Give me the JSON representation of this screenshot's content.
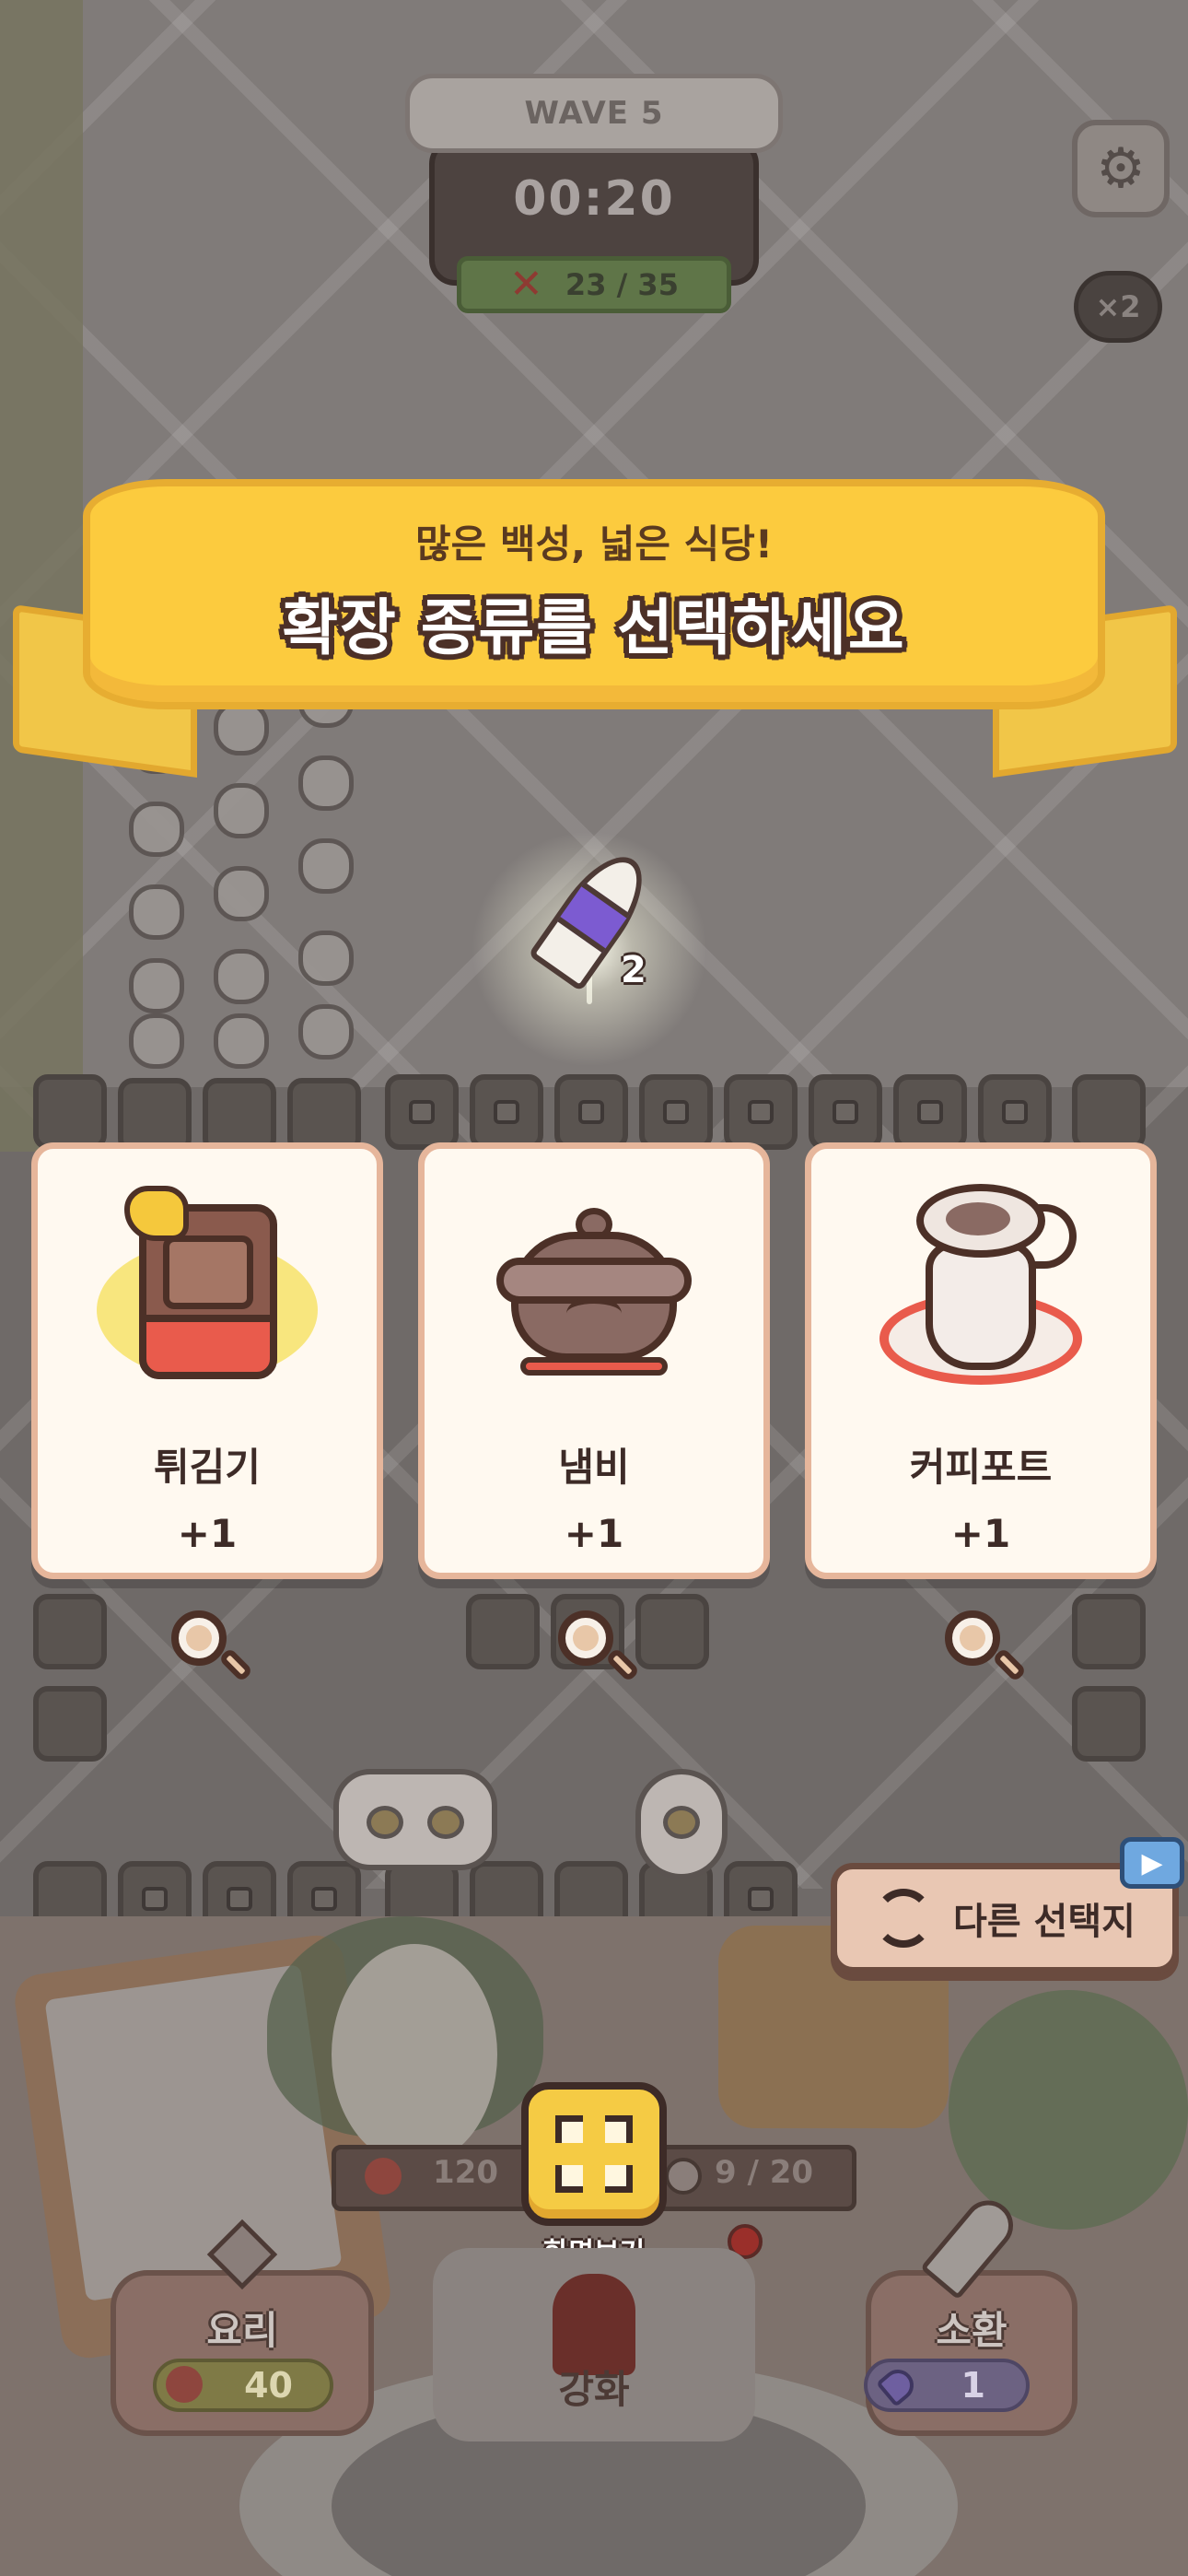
{
  "hud": {
    "wave_label": "WAVE 5",
    "timer": "00:20",
    "kill_count": "23 / 35",
    "speed_label": "×2",
    "settings_icon": "gear-icon"
  },
  "banner": {
    "subtitle": "많은 백성, 넓은 식당!",
    "title": "확장 종류를 선택하세요"
  },
  "reward": {
    "icon": "horn-icon",
    "count": "2"
  },
  "choices": [
    {
      "name": "튀김기",
      "bonus": "+1",
      "icon": "fryer-icon"
    },
    {
      "name": "냄비",
      "bonus": "+1",
      "icon": "pot-icon"
    },
    {
      "name": "커피포트",
      "bonus": "+1",
      "icon": "coffee-pot-icon"
    }
  ],
  "reroll": {
    "label": "다른 선택지",
    "icon": "refresh-icon",
    "ad_icon": "play-icon"
  },
  "bottom": {
    "hearts": "120",
    "customers": "9 / 20",
    "view_label": "화면보기",
    "cook": {
      "label": "요리",
      "cost": "40"
    },
    "upgrade": {
      "label": "강화"
    },
    "summon": {
      "label": "소환",
      "cost": "1"
    }
  },
  "colors": {
    "banner_yellow": "#fccb3e",
    "card_bg": "#fff9f0",
    "card_border": "#e6b69b",
    "outline": "#3d2b27",
    "view_button": "#f5cb44",
    "reroll_button": "#e9c7b3"
  }
}
